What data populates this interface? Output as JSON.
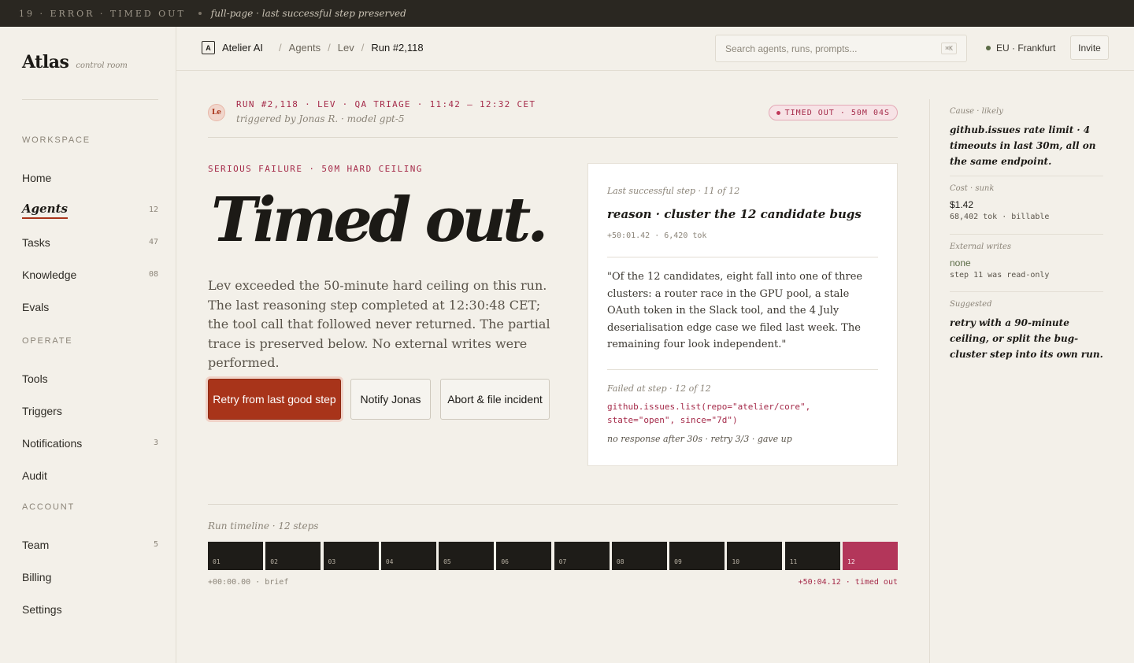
{
  "topstrip": {
    "code": "19 · ERROR · TIMED OUT",
    "note": "full-page · last successful step preserved"
  },
  "brand": {
    "name": "Atlas",
    "sub": "control room"
  },
  "sidebar": {
    "sections": [
      {
        "title": "WORKSPACE",
        "items": [
          {
            "label": "Home",
            "count": ""
          },
          {
            "label": "Agents",
            "count": "12",
            "active": true
          },
          {
            "label": "Tasks",
            "count": "47"
          },
          {
            "label": "Knowledge",
            "count": "08"
          },
          {
            "label": "Evals",
            "count": ""
          }
        ]
      },
      {
        "title": "OPERATE",
        "items": [
          {
            "label": "Tools",
            "count": ""
          },
          {
            "label": "Triggers",
            "count": ""
          },
          {
            "label": "Notifications",
            "count": "3"
          },
          {
            "label": "Audit",
            "count": ""
          }
        ]
      },
      {
        "title": "ACCOUNT",
        "items": [
          {
            "label": "Team",
            "count": "5"
          },
          {
            "label": "Billing",
            "count": ""
          },
          {
            "label": "Settings",
            "count": ""
          }
        ]
      }
    ]
  },
  "header": {
    "org_badge": "A",
    "org": "Atelier AI",
    "crumbs": [
      "Agents",
      "Lev",
      "Run #2,118"
    ],
    "search_placeholder": "Search agents, runs, prompts...",
    "search_kbd": "⌘K",
    "region": "EU · Frankfurt",
    "invite": "Invite"
  },
  "run": {
    "avatar": "Le",
    "title": "RUN #2,118 · LEV · QA TRIAGE · 11:42 — 12:32 CET",
    "sub": "triggered by Jonas R. · model gpt-5",
    "status": "TIMED OUT · 50M 04S"
  },
  "main": {
    "eyebrow": "SERIOUS FAILURE · 50M HARD CEILING",
    "title": "Timed out.",
    "lede": "Lev exceeded the 50-minute hard ceiling on this run. The last reasoning step completed at 12:30:48 CET; the tool call that followed never returned. The partial trace is preserved below. No external writes were performed.",
    "buttons": {
      "retry": "Retry from last good step",
      "notify": "Notify Jonas",
      "abort": "Abort & file incident"
    }
  },
  "trace": {
    "last_label": "Last successful step · 11 of 12",
    "step_title": "reason · cluster the 12 candidate bugs",
    "step_meta": "+50:01.42 · 6,420 tok",
    "quote": "\"Of the 12 candidates, eight fall into one of three clusters: a router race in the GPU pool, a stale OAuth token in the Slack tool, and the 4 July deserialisation edge case we filed last week. The remaining four look independent.\"",
    "failed_label": "Failed at step · 12 of 12",
    "code": "github.issues.list(repo=\"atelier/core\", state=\"open\", since=\"7d\")",
    "failure": "no response after 30s · retry 3/3 · gave up"
  },
  "rail": {
    "cause_label": "Cause · likely",
    "cause_text": "github.issues rate limit · 4 timeouts in last 30m, all on the same endpoint.",
    "cost_label": "Cost · sunk",
    "cost_value": "$1.42",
    "cost_meta": "68,402 tok · billable",
    "writes_label": "External writes",
    "writes_value": "none",
    "writes_meta": "step 11 was read-only",
    "suggest_label": "Suggested",
    "suggest_text": "retry with a 90-minute ceiling, or split the bug-cluster step into its own run."
  },
  "timeline": {
    "label": "Run timeline · 12 steps",
    "steps": [
      "01",
      "02",
      "03",
      "04",
      "05",
      "06",
      "07",
      "08",
      "09",
      "10",
      "11",
      "12"
    ],
    "failed_index": 11,
    "start": "+00:00.00 · brief",
    "end": "+50:04.12 · timed out"
  },
  "colors": {
    "accent": "#a8341a",
    "error": "#a52b4a",
    "failed_step": "#b3365a",
    "ok_green": "#5b6b46"
  }
}
